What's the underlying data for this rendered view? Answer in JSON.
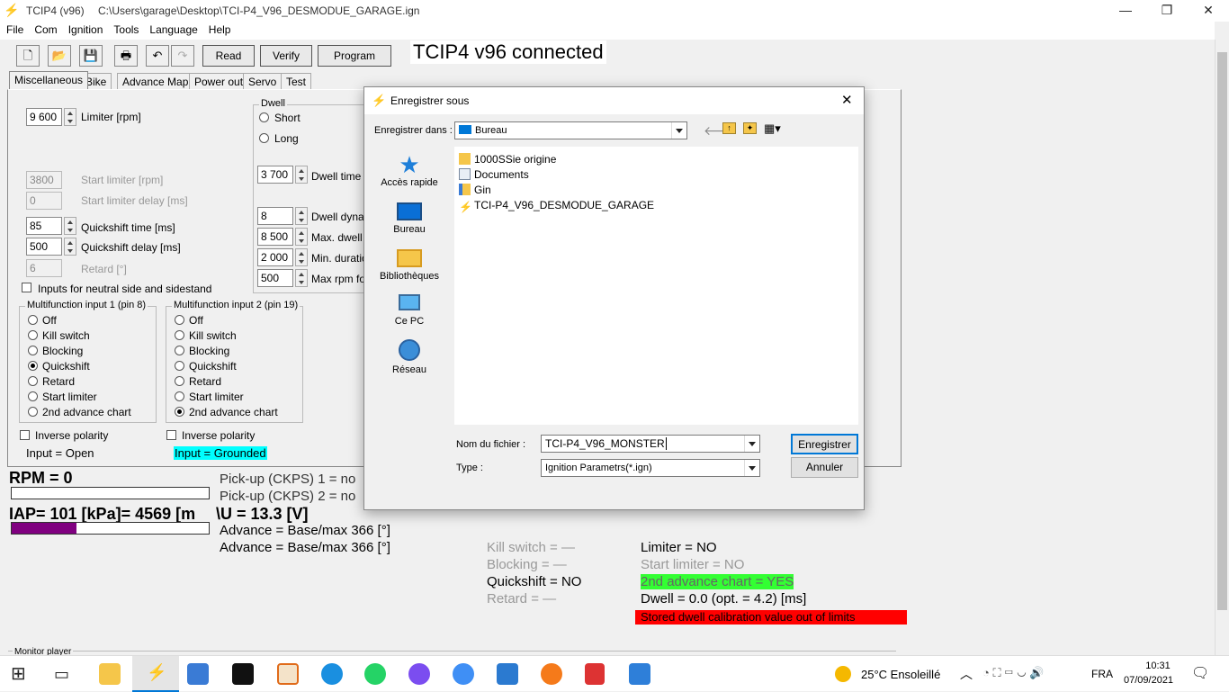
{
  "window": {
    "app": "TCIP4 (v96)",
    "path": "C:\\Users\\garage\\Desktop\\TCI-P4_V96_DESMODUE_GARAGE.ign"
  },
  "menu": [
    "File",
    "Com",
    "Ignition",
    "Tools",
    "Language",
    "Help"
  ],
  "toolbar": {
    "read": "Read",
    "verify": "Verify",
    "program": "Program"
  },
  "status": "TCIP4 v96 connected",
  "tabs": [
    "Miscellaneous",
    "Bike",
    "Advance Map",
    "Power out",
    "Servo",
    "Test"
  ],
  "misc": {
    "limiter": {
      "value": "9 600",
      "label": "Limiter [rpm]"
    },
    "start_limiter": {
      "value": "3800",
      "label": "Start limiter [rpm]"
    },
    "start_delay": {
      "value": "0",
      "label": "Start limiter delay [ms]"
    },
    "qs_time": {
      "value": "85",
      "label": "Quickshift time [ms]"
    },
    "qs_delay": {
      "value": "500",
      "label": "Quickshift delay [ms]"
    },
    "retard": {
      "value": "6",
      "label": "Retard [°]"
    },
    "neutral_label": "Inputs for neutral side and sidestand",
    "mf1_title": "Multifunction input 1 (pin 8)",
    "mf2_title": "Multifunction input 2 (pin 19)",
    "options": [
      "Off",
      "Kill switch",
      "Blocking",
      "Quickshift",
      "Retard",
      "Start limiter",
      "2nd advance chart"
    ],
    "inverse": "Inverse polarity",
    "input1_state": "Input = Open",
    "input2_state": "Input = Grounded"
  },
  "dwell": {
    "title": "Dwell",
    "short": "Short",
    "long": "Long",
    "dwell_time": {
      "value": "3 700",
      "label": "Dwell time [u"
    },
    "dyn": {
      "value": "8",
      "label": "Dwell dynam"
    },
    "max": {
      "value": "8 500",
      "label": "Max. dwell ti"
    },
    "min": {
      "value": "2 000",
      "label": "Min. duration"
    },
    "rpm": {
      "value": "500",
      "label": "Max rpm for"
    }
  },
  "live": {
    "rpm": "RPM = 0",
    "iap": "IAP= 101 [kPa]= 4569 [m",
    "pickup1": "Pick-up (CKPS) 1 = no",
    "pickup2": "Pick-up (CKPS) 2 = no",
    "voltage": "\\U = 13.3 [V]",
    "adv1": "Advance = Base/max 366 [°]",
    "adv2": "Advance = Base/max 366 [°]",
    "kill": "Kill switch = —",
    "blocking": "Blocking = —",
    "quickshift": "Quickshift = NO",
    "retard": "Retard = —",
    "limiter": "Limiter = NO",
    "start_limiter": "Start limiter = NO",
    "adv2chart": "2nd advance chart = YES",
    "dwell": "Dwell = 0.0 (opt. = 4.2) [ms]",
    "warning": "Stored dwell calibration value out of limits",
    "monitor": "Monitor player",
    "iap_bar_fraction": 0.33
  },
  "dialog": {
    "title": "Enregistrer sous",
    "save_in_label": "Enregistrer dans :",
    "save_in": "Bureau",
    "places": [
      "Accès rapide",
      "Bureau",
      "Bibliothèques",
      "Ce PC",
      "Réseau"
    ],
    "files": [
      "1000SSie origine",
      "Documents",
      "Gin",
      "TCI-P4_V96_DESMODUE_GARAGE"
    ],
    "filename_label": "Nom du fichier :",
    "filename": "TCI-P4_V96_MONSTER",
    "type_label": "Type :",
    "type": "Ignition Parametrs(*.ign)",
    "save": "Enregistrer",
    "cancel": "Annuler"
  },
  "taskbar": {
    "weather": "25°C  Ensoleillé",
    "lang": "FRA",
    "time": "10:31",
    "date": "07/09/2021"
  },
  "colors": {
    "cyan": "#00ffff",
    "green": "#33ff33",
    "red": "#ff0000",
    "iap_bar": "#800080",
    "folder": "#f5c64a",
    "accent": "#0078d7"
  }
}
